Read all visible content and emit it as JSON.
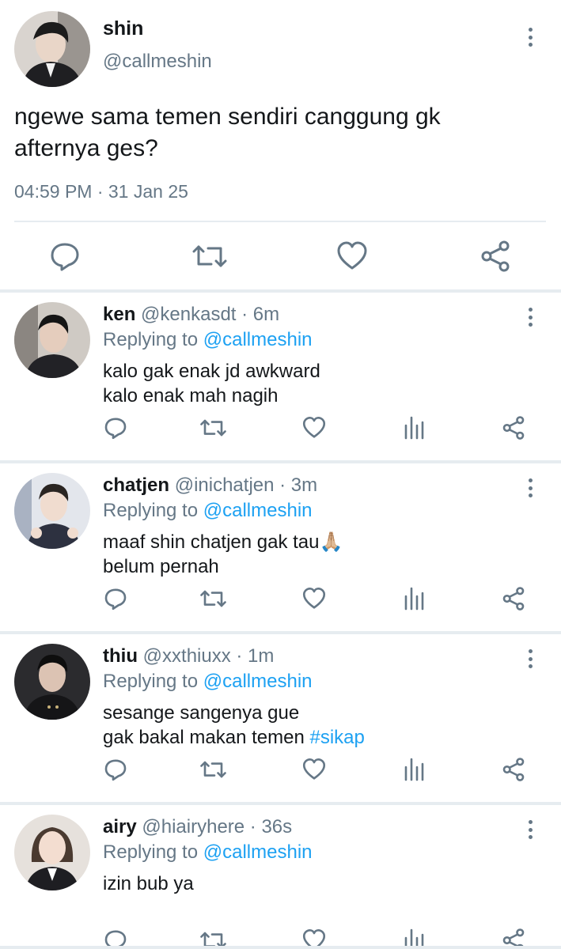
{
  "main_tweet": {
    "display_name": "shin",
    "handle": "@callmeshin",
    "text_line1": "ngewe sama temen sendiri canggung gk",
    "text_line2": "afternya ges?",
    "timestamp": "04:59 PM · 31 Jan 25",
    "icons": [
      "reply-icon",
      "retweet-icon",
      "like-icon",
      "share-icon"
    ]
  },
  "replies": [
    {
      "display_name": "ken",
      "meta": "@kenkasdt · 6m",
      "replying_prefix": "Replying to ",
      "replying_handle": "@callmeshin",
      "line1": "kalo gak enak jd awkward",
      "line2": "kalo enak mah nagih"
    },
    {
      "display_name": "chatjen",
      "meta": "@inichatjen · 3m",
      "replying_prefix": "Replying to ",
      "replying_handle": "@callmeshin",
      "line1": "maaf shin chatjen gak tau🙏🏼",
      "line2": "belum pernah"
    },
    {
      "display_name": "thiu",
      "meta": "@xxthiuxx · 1m",
      "replying_prefix": "Replying to ",
      "replying_handle": "@callmeshin",
      "line1": "sesange sangenya gue",
      "line2_text": "gak bakal makan temen ",
      "line2_hashtag": "#sikap"
    },
    {
      "display_name": "airy",
      "meta": "@hiairyhere · 36s",
      "replying_prefix": "Replying to ",
      "replying_handle": "@callmeshin",
      "line1": "izin bub ya"
    }
  ],
  "colors": {
    "text": "#14171a",
    "secondary": "#657786",
    "accent": "#1da1f2",
    "divider": "#e6ecf0"
  }
}
